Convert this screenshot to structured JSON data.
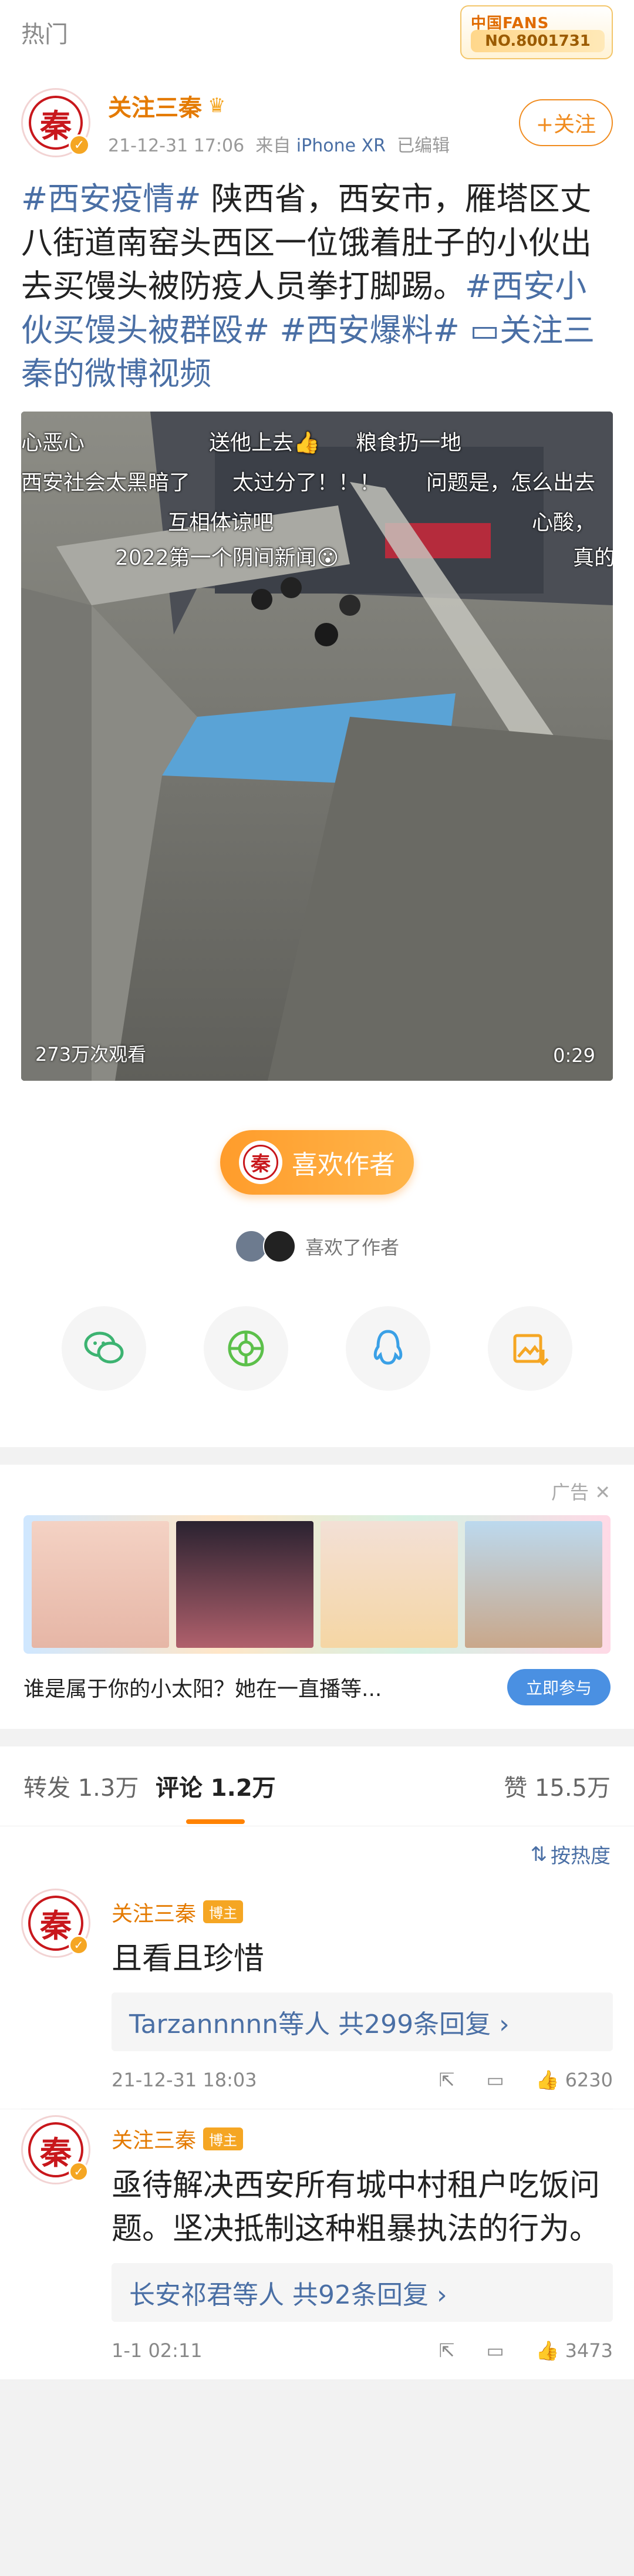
{
  "topbar": {
    "label": "热门",
    "fans_badge_title": "中国FANS",
    "fans_badge_number": "NO.8001731"
  },
  "post": {
    "author": {
      "avatar_text": "秦",
      "name": "关注三秦",
      "time": "21-12-31 17:06",
      "source_prefix": "来自",
      "device": "iPhone XR",
      "edited": "已编辑",
      "follow_label": "+关注"
    },
    "text_parts": {
      "tag1": "#西安疫情#",
      "body": " 陕西省，西安市，雁塔区丈八街道南窑头西区一位饿着肚子的小伙出去买馒头被防疫人员拳打脚踢。",
      "tag2": "#西安小伙买馒头被群殴#",
      "tag3": " #西安爆料#",
      "video_link": " ▭关注三秦的微博视频"
    },
    "video": {
      "danmaku": [
        "心恶心",
        "送他上去👍",
        "粮食扔一地",
        "西安社会太黑暗了",
        "太过分了！！！",
        "问题是，怎么出去",
        "互相体谅吧",
        "心酸，",
        "2022第一个阴间新闻😮",
        "真的"
      ],
      "views": "273万次观看",
      "duration": "0:29"
    },
    "like_author_label": "喜欢作者",
    "liked_by_label": "喜欢了作者",
    "share_icons": [
      "wechat-icon",
      "moments-icon",
      "qq-icon",
      "save-image-icon"
    ]
  },
  "ad": {
    "tag": "广告",
    "text": "谁是属于你的小太阳？她在一直播等...",
    "cta": "立即参与"
  },
  "tabs": {
    "repost": "转发 1.3万",
    "comments": "评论 1.2万",
    "likes": "赞 15.5万",
    "sort": "按热度"
  },
  "comments": [
    {
      "name": "关注三秦",
      "badge": "博主",
      "text": "且看且珍惜",
      "replies": "Tarzannnnn等人  共299条回复 ›",
      "time": "21-12-31 18:03",
      "likes": "6230"
    },
    {
      "name": "关注三秦",
      "badge": "博主",
      "text": "亟待解决西安所有城中村租户吃饭问题。坚决抵制这种粗暴执法的行为。",
      "replies": "长安祁君等人  共92条回复 ›",
      "time": "1-1 02:11",
      "likes": "3473"
    }
  ],
  "colors": {
    "accent": "#ff8200",
    "link": "#4a6fa5",
    "author": "#e47a00"
  }
}
